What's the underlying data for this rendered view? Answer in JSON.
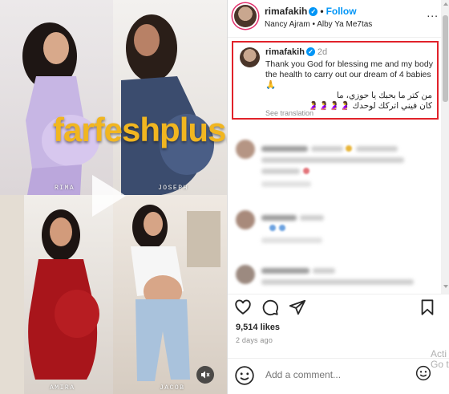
{
  "media": {
    "watermark": "farfeshplus.com",
    "captions": [
      "RIMA",
      "JOSEPH",
      "AMIRA",
      "JACOB"
    ]
  },
  "header": {
    "username": "rimafakih",
    "follow_label": "Follow",
    "audio": "Nancy Ajram • Alby Ya Me7tas",
    "more": "..."
  },
  "post_caption": {
    "username": "rimafakih",
    "time": "2d",
    "text": "Thank you God for blessing me and my body the health to carry out our dream of 4 babies 🙏",
    "arabic_line1": "من كتر ما بحبك يا حوزي، ما",
    "arabic_line2": "كان فيني اتركك لوحدك 🤰🤰🤰🤰",
    "see_translation": "See translation"
  },
  "post_footer": {
    "likes": "9,514 likes",
    "time_ago": "2 days ago",
    "add_comment_placeholder": "Add a comment...",
    "activate_text": "Acti\nGo t"
  },
  "colors": {
    "accent": "#0095f6",
    "highlight_box": "#e1222a",
    "watermark": "#f1b620"
  },
  "icons": {
    "like": "heart-icon",
    "comment": "comment-icon",
    "share": "share-icon",
    "save": "bookmark-icon",
    "emoji": "emoji-icon",
    "mute": "speaker-muted-icon",
    "play": "play-icon"
  }
}
